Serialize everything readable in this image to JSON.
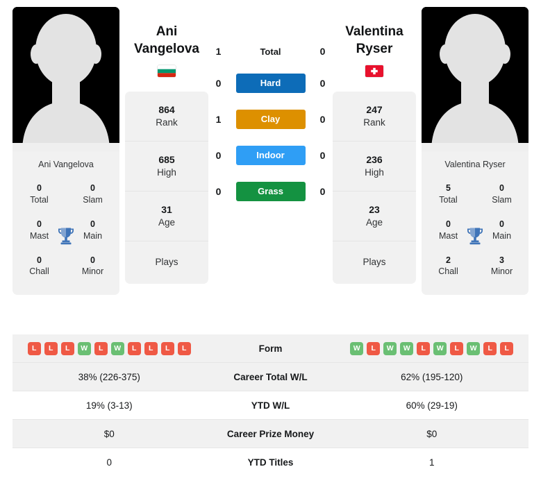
{
  "players": {
    "left": {
      "name_line1": "Ani",
      "name_line2": "Vangelova",
      "full_name": "Ani Vangelova",
      "country_flag": "bulgaria-flag",
      "rank": "864",
      "rank_label": "Rank",
      "high": "685",
      "high_label": "High",
      "age": "31",
      "age_label": "Age",
      "plays_label": "Plays",
      "plays_value": "",
      "titles": {
        "total": "0",
        "total_label": "Total",
        "slam": "0",
        "slam_label": "Slam",
        "mast": "0",
        "mast_label": "Mast",
        "main": "0",
        "main_label": "Main",
        "chall": "0",
        "chall_label": "Chall",
        "minor": "0",
        "minor_label": "Minor"
      },
      "form": [
        "L",
        "L",
        "L",
        "W",
        "L",
        "W",
        "L",
        "L",
        "L",
        "L"
      ],
      "career_total_wl": "38% (226-375)",
      "ytd_wl": "19% (3-13)",
      "career_prize_money": "$0",
      "ytd_titles": "0"
    },
    "right": {
      "name_line1": "Valentina",
      "name_line2": "Ryser",
      "full_name": "Valentina Ryser",
      "country_flag": "switzerland-flag",
      "rank": "247",
      "rank_label": "Rank",
      "high": "236",
      "high_label": "High",
      "age": "23",
      "age_label": "Age",
      "plays_label": "Plays",
      "plays_value": "",
      "titles": {
        "total": "5",
        "total_label": "Total",
        "slam": "0",
        "slam_label": "Slam",
        "mast": "0",
        "mast_label": "Mast",
        "main": "0",
        "main_label": "Main",
        "chall": "2",
        "chall_label": "Chall",
        "minor": "3",
        "minor_label": "Minor"
      },
      "form": [
        "W",
        "L",
        "W",
        "W",
        "L",
        "W",
        "L",
        "W",
        "L",
        "L"
      ],
      "career_total_wl": "62% (195-120)",
      "ytd_wl": "60% (29-19)",
      "career_prize_money": "$0",
      "ytd_titles": "1"
    }
  },
  "head_to_head": [
    {
      "label": "Total",
      "left": "1",
      "right": "0",
      "style": "plain",
      "color": ""
    },
    {
      "label": "Hard",
      "left": "0",
      "right": "0",
      "style": "badge",
      "color": "#0d6cb8"
    },
    {
      "label": "Clay",
      "left": "1",
      "right": "0",
      "style": "badge",
      "color": "#dd9000"
    },
    {
      "label": "Indoor",
      "left": "0",
      "right": "0",
      "style": "badge",
      "color": "#2f9ef5"
    },
    {
      "label": "Grass",
      "left": "0",
      "right": "0",
      "style": "badge",
      "color": "#149241"
    }
  ],
  "comparison_rows": [
    {
      "label": "Form",
      "left": "",
      "right": "",
      "type": "form",
      "shaded": true
    },
    {
      "label": "Career Total W/L",
      "left": "38% (226-375)",
      "right": "62% (195-120)",
      "type": "text",
      "shaded": true
    },
    {
      "label": "YTD W/L",
      "left": "19% (3-13)",
      "right": "60% (29-19)",
      "type": "text",
      "shaded": false
    },
    {
      "label": "Career Prize Money",
      "left": "$0",
      "right": "$0",
      "type": "text",
      "shaded": true
    },
    {
      "label": "YTD Titles",
      "left": "0",
      "right": "1",
      "type": "text",
      "shaded": false
    }
  ],
  "colors": {
    "win_badge": "#6abf73",
    "loss_badge": "#ef5945",
    "card_bg": "#f1f1f1",
    "trophy": "#3f74b8"
  },
  "icons": {
    "trophy": "trophy-icon",
    "avatar": "avatar-silhouette-icon"
  }
}
